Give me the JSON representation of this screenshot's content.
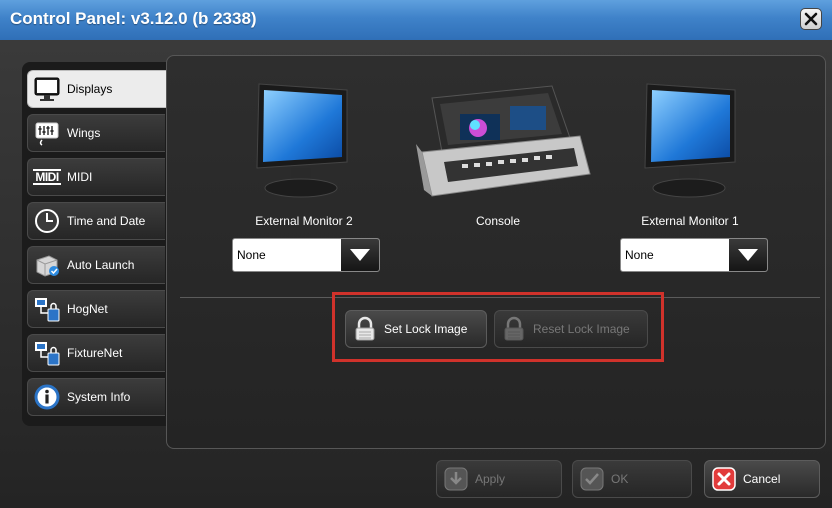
{
  "window": {
    "title": "Control Panel: v3.12.0 (b 2338)"
  },
  "tabs": [
    {
      "label": "Displays",
      "icon": "monitor-icon",
      "active": true
    },
    {
      "label": "Wings",
      "icon": "wing-icon"
    },
    {
      "label": "MIDI",
      "icon": "midi-icon",
      "icon_text": "MIDI"
    },
    {
      "label": "Time and Date",
      "icon": "clock-icon"
    },
    {
      "label": "Auto Launch",
      "icon": "auto-launch-icon"
    },
    {
      "label": "HogNet",
      "icon": "network-icon"
    },
    {
      "label": "FixtureNet",
      "icon": "network-icon"
    },
    {
      "label": "System Info",
      "icon": "info-icon"
    }
  ],
  "displays": {
    "ext_monitor_2": {
      "label": "External Monitor 2",
      "selected": "None"
    },
    "console": {
      "label": "Console"
    },
    "ext_monitor_1": {
      "label": "External Monitor 1",
      "selected": "None"
    }
  },
  "lock": {
    "set_label": "Set Lock Image",
    "reset_label": "Reset Lock Image"
  },
  "footer": {
    "apply_label": "Apply",
    "ok_label": "OK",
    "cancel_label": "Cancel"
  },
  "colors": {
    "titlebar": "#3f82c9",
    "highlight": "#d0322b",
    "cancel_icon": "#e23b3b"
  }
}
